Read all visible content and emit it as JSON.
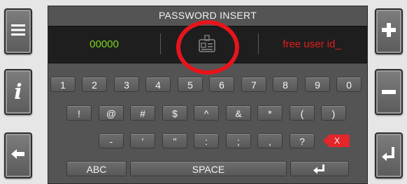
{
  "window": {
    "title": "PASSWORD INSERT"
  },
  "fields": {
    "code_value": "00000",
    "user_id_value": "free user id_"
  },
  "side_buttons": {
    "menu_icon": "hamburger-menu-icon",
    "info_label": "i",
    "back_icon": "arrow-left-icon",
    "plus_label": "+",
    "minus_label": "−",
    "enter_icon": "enter-icon"
  },
  "keyboard": {
    "row1": [
      "1",
      "2",
      "3",
      "4",
      "5",
      "6",
      "7",
      "8",
      "9",
      "0"
    ],
    "row2": [
      "!",
      "@",
      "#",
      "$",
      "^",
      "&",
      "*",
      "(",
      ")"
    ],
    "row3": [
      "-",
      "'",
      "''",
      ":",
      ";",
      ",",
      "?"
    ],
    "backspace_label": "X",
    "abc_label": "ABC",
    "space_label": "SPACE",
    "enter_icon": "enter-arrow-icon"
  },
  "colors": {
    "code": "#7ed321",
    "user_id": "#e31c1c",
    "highlight": "#e8141c",
    "backspace": "#e3262b"
  }
}
